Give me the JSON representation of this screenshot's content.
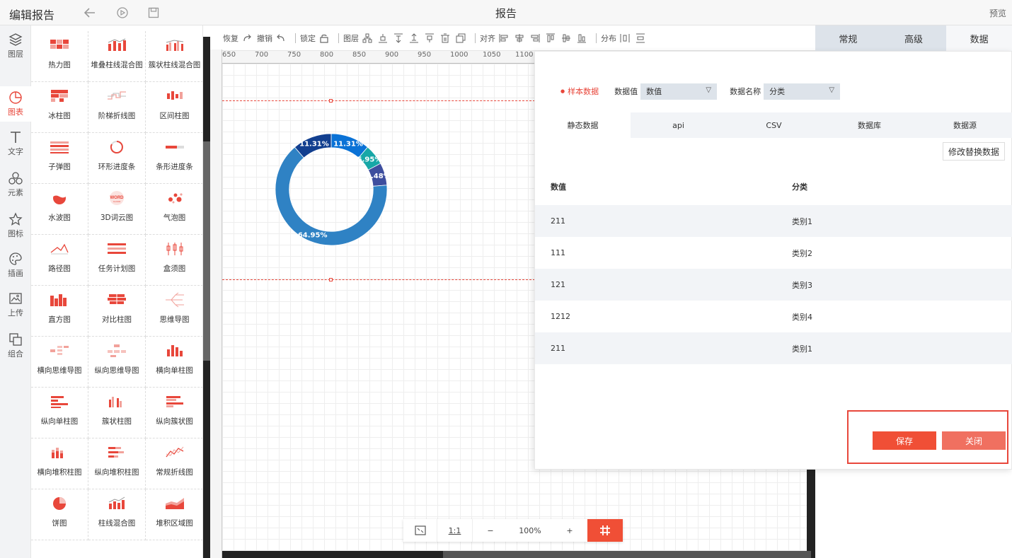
{
  "topbar": {
    "title": "编辑报告",
    "center_title": "报告",
    "preview": "预览"
  },
  "leftnav": [
    {
      "label": "图层",
      "icon": "layers-icon"
    },
    {
      "label": "图表",
      "icon": "chart-icon",
      "active": true
    },
    {
      "label": "文字",
      "icon": "text-icon"
    },
    {
      "label": "元素",
      "icon": "elements-icon"
    },
    {
      "label": "图标",
      "icon": "star-icon"
    },
    {
      "label": "插画",
      "icon": "palette-icon"
    },
    {
      "label": "上传",
      "icon": "upload-icon"
    },
    {
      "label": "组合",
      "icon": "group-icon"
    }
  ],
  "components": [
    {
      "label": "热力图",
      "icon": "heatmap-icon"
    },
    {
      "label": "堆叠柱线混合图",
      "icon": "stacked-bar-line-icon"
    },
    {
      "label": "簇状柱线混合图",
      "icon": "clustered-bar-line-icon"
    },
    {
      "label": "冰柱图",
      "icon": "icicle-icon"
    },
    {
      "label": "阶梯折线图",
      "icon": "step-line-icon"
    },
    {
      "label": "区间柱图",
      "icon": "range-bar-icon"
    },
    {
      "label": "子弹图",
      "icon": "bullet-chart-icon"
    },
    {
      "label": "环形进度条",
      "icon": "ring-progress-icon"
    },
    {
      "label": "条形进度条",
      "icon": "bar-progress-icon"
    },
    {
      "label": "水波图",
      "icon": "liquid-icon"
    },
    {
      "label": "3D词云图",
      "icon": "word-cloud-icon"
    },
    {
      "label": "气泡图",
      "icon": "bubble-icon"
    },
    {
      "label": "路径图",
      "icon": "path-icon"
    },
    {
      "label": "任务计划图",
      "icon": "gantt-icon"
    },
    {
      "label": "盒须图",
      "icon": "boxplot-icon"
    },
    {
      "label": "直方图",
      "icon": "histogram-icon"
    },
    {
      "label": "对比柱图",
      "icon": "compare-bar-icon"
    },
    {
      "label": "思维导图",
      "icon": "mindmap-icon"
    },
    {
      "label": "横向思维导图",
      "icon": "h-mindmap-icon"
    },
    {
      "label": "纵向思维导图",
      "icon": "v-mindmap-icon"
    },
    {
      "label": "横向单柱图",
      "icon": "h-single-bar-icon"
    },
    {
      "label": "纵向单柱图",
      "icon": "v-single-bar-icon"
    },
    {
      "label": "簇状柱图",
      "icon": "clustered-bar-icon"
    },
    {
      "label": "纵向簇状图",
      "icon": "v-clustered-icon"
    },
    {
      "label": "横向堆积柱图",
      "icon": "h-stacked-bar-icon"
    },
    {
      "label": "纵向堆积柱图",
      "icon": "v-stacked-bar-icon"
    },
    {
      "label": "常规折线图",
      "icon": "line-chart-icon"
    },
    {
      "label": "饼图",
      "icon": "pie-icon"
    },
    {
      "label": "柱线混合图",
      "icon": "bar-line-icon"
    },
    {
      "label": "堆积区域图",
      "icon": "stacked-area-icon"
    }
  ],
  "toolbar": {
    "redo": "恢复",
    "undo": "撤销",
    "lock": "锁定",
    "layer": "图层",
    "align": "对齐",
    "distribute": "分布"
  },
  "ruler_ticks": [
    "650",
    "700",
    "750",
    "800",
    "850",
    "900",
    "950",
    "1000",
    "1050",
    "1100"
  ],
  "right_tabs": [
    {
      "label": "常规"
    },
    {
      "label": "高级"
    },
    {
      "label": "数据",
      "active": true
    }
  ],
  "data_panel": {
    "sample_label": "样本数据",
    "value_label": "数据值",
    "value_select": "数值",
    "name_label": "数据名称",
    "name_select": "分类",
    "source_tabs": [
      "静态数据",
      "api",
      "CSV",
      "数据库",
      "数据源"
    ],
    "modify_button": "修改替换数据",
    "columns": [
      "数值",
      "分类"
    ],
    "rows": [
      [
        "211",
        "类别1"
      ],
      [
        "111",
        "类别2"
      ],
      [
        "121",
        "类别3"
      ],
      [
        "1212",
        "类别4"
      ],
      [
        "211",
        "类别1"
      ]
    ],
    "save": "保存",
    "close": "关闭"
  },
  "zoom": {
    "ratio": "1:1",
    "minus": "−",
    "level": "100%",
    "plus": "+"
  },
  "chart_data": {
    "type": "pie",
    "hole": 0.75,
    "categories": [
      "类别1",
      "类别2",
      "类别3",
      "类别4",
      "类别1"
    ],
    "values": [
      211,
      111,
      121,
      1212,
      211
    ],
    "labels": [
      "11.31%",
      "5.95%",
      "6.48%",
      "64.95%",
      "11.31%"
    ],
    "colors": [
      "#0a72d6",
      "#17a7a7",
      "#3e4e9e",
      "#2f82c4",
      "#123f8f"
    ]
  }
}
